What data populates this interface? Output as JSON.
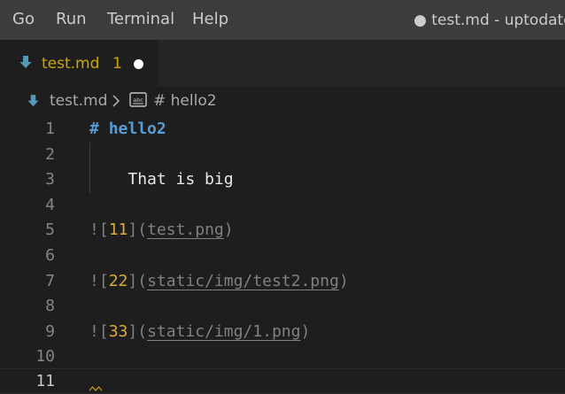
{
  "menubar": {
    "items": [
      "Go",
      "Run",
      "Terminal",
      "Help"
    ],
    "title": "● test.md - uptodate"
  },
  "tab": {
    "name": "test.md",
    "problem_count": "1",
    "modified": true
  },
  "breadcrumb": {
    "file": "test.md",
    "symbol": "# hello2"
  },
  "editor": {
    "lines": [
      {
        "n": "1"
      },
      {
        "n": "2"
      },
      {
        "n": "3"
      },
      {
        "n": "4"
      },
      {
        "n": "5"
      },
      {
        "n": "6"
      },
      {
        "n": "7"
      },
      {
        "n": "8"
      },
      {
        "n": "9"
      },
      {
        "n": "10"
      },
      {
        "n": "11"
      }
    ],
    "line1_hash": "#",
    "line1_heading": "hello2",
    "line3_text": "That is big",
    "line5_alt": "11",
    "line5_url": "test.png",
    "line7_alt": "22",
    "line7_url": "static/img/test2.png",
    "line9_alt": "33",
    "line9_url": "static/img/1.png",
    "active_line": "11"
  },
  "colors": {
    "menubar_bg": "#3c3c3c",
    "editor_bg": "#1e1e1e",
    "warning": "#cca700",
    "heading": "#569cd6",
    "markdown_punct": "#808080"
  }
}
